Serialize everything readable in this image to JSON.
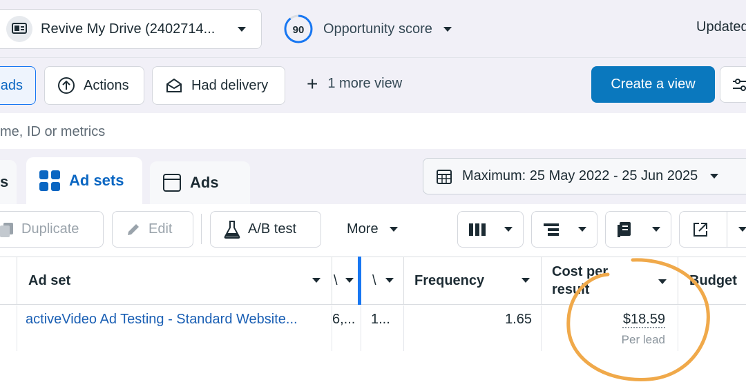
{
  "topbar": {
    "account_name": "Revive My Drive (2402714...",
    "opportunity_score": "90",
    "opportunity_label": "Opportunity score",
    "updated_label": "Updated"
  },
  "views": {
    "ads_chip": "ads",
    "actions": "Actions",
    "had_delivery": "Had delivery",
    "more_view": "1 more view",
    "create_view": "Create a view"
  },
  "search": {
    "placeholder": "me, ID or metrics"
  },
  "tabs": {
    "campaigns_partial": "s",
    "ad_sets": "Ad sets",
    "ads": "Ads"
  },
  "date_range": "Maximum: 25 May 2022 - 25 Jun 2025",
  "toolbar": {
    "duplicate": "Duplicate",
    "edit": "Edit",
    "ab_test": "A/B test",
    "more": "More"
  },
  "table": {
    "columns": {
      "ad_set": "Ad set",
      "col1": "\\",
      "col2": "\\",
      "frequency": "Frequency",
      "cost_per_result": "Cost per result",
      "budget": "Budget"
    },
    "rows": [
      {
        "ad_set": "activeVideo Ad Testing - Standard Website...",
        "col1": "6,...",
        "col2": "1...",
        "frequency": "1.65",
        "cost_per_result": "$18.59",
        "cost_per_result_sub": "Per lead"
      }
    ]
  },
  "colors": {
    "accent_blue": "#0a78be",
    "link_blue": "#1a5fb4",
    "annotation_orange": "#f0a94a",
    "score_ring": "#1877f2"
  }
}
